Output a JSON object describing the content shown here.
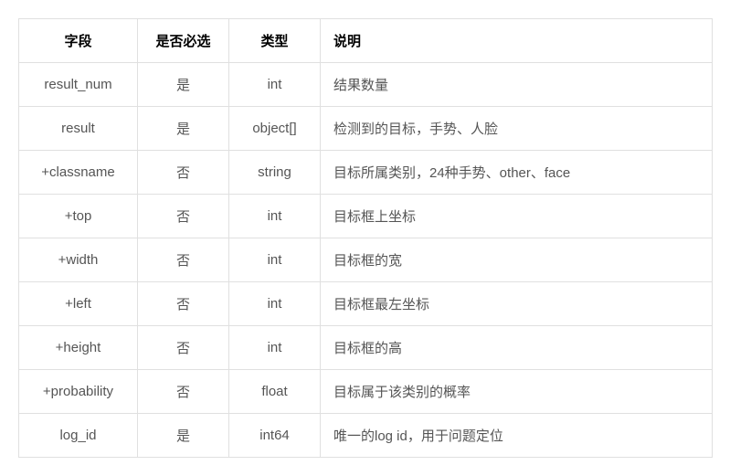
{
  "headers": {
    "field": "字段",
    "required": "是否必选",
    "type": "类型",
    "desc": "说明"
  },
  "rows": [
    {
      "field": "result_num",
      "required": "是",
      "type": "int",
      "desc": "结果数量"
    },
    {
      "field": "result",
      "required": "是",
      "type": "object[]",
      "desc": "检测到的目标，手势、人脸"
    },
    {
      "field": "+classname",
      "required": "否",
      "type": "string",
      "desc": "目标所属类别，24种手势、other、face"
    },
    {
      "field": "+top",
      "required": "否",
      "type": "int",
      "desc": "目标框上坐标"
    },
    {
      "field": "+width",
      "required": "否",
      "type": "int",
      "desc": "目标框的宽"
    },
    {
      "field": "+left",
      "required": "否",
      "type": "int",
      "desc": "目标框最左坐标"
    },
    {
      "field": "+height",
      "required": "否",
      "type": "int",
      "desc": "目标框的高"
    },
    {
      "field": "+probability",
      "required": "否",
      "type": "float",
      "desc": "目标属于该类别的概率"
    },
    {
      "field": "log_id",
      "required": "是",
      "type": "int64",
      "desc": "唯一的log id，用于问题定位"
    }
  ]
}
